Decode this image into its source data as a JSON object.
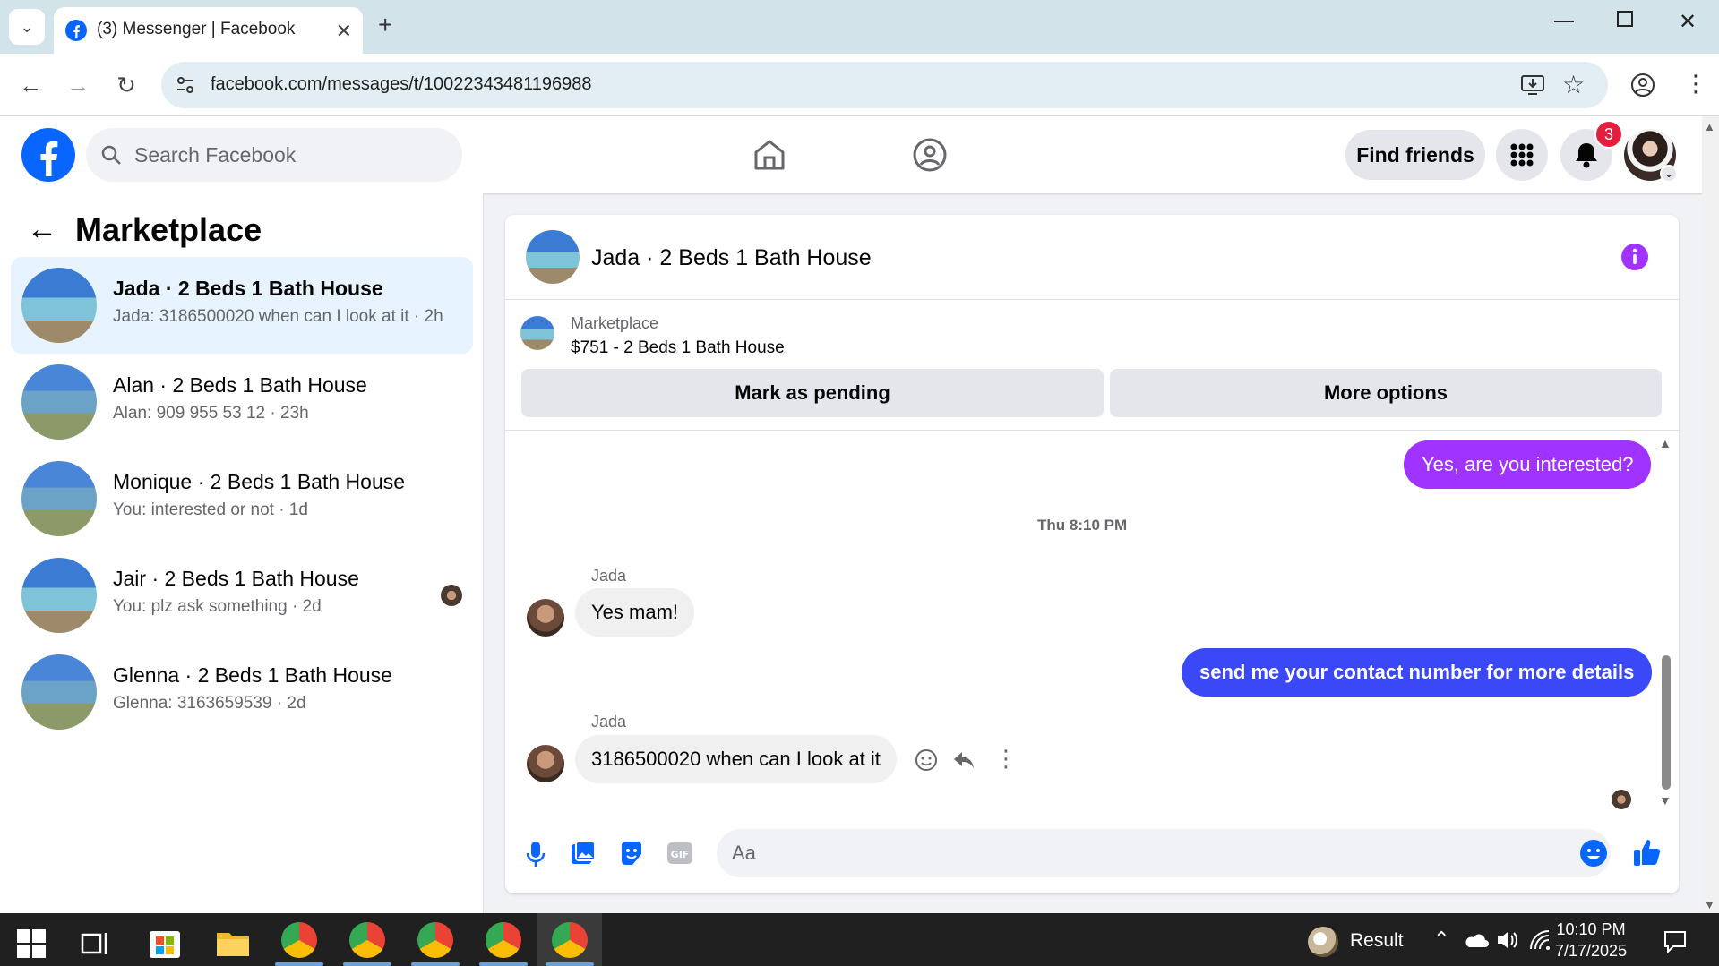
{
  "browser": {
    "tab_title": "(3) Messenger | Facebook",
    "url": "facebook.com/messages/t/10022343481196988"
  },
  "header": {
    "search_placeholder": "Search Facebook",
    "find_friends_label": "Find friends",
    "notification_count": "3"
  },
  "sidebar": {
    "title": "Marketplace",
    "conversations": [
      {
        "name": "Jada · 2 Beds 1 Bath House",
        "preview": "Jada: 3186500020 when can I look at it · 2h",
        "active": true
      },
      {
        "name": "Alan · 2 Beds 1 Bath House",
        "preview": "Alan: 909 955 53 12 · 23h",
        "active": false
      },
      {
        "name": "Monique · 2 Beds 1 Bath House",
        "preview": "You: interested or not · 1d",
        "active": false
      },
      {
        "name": "Jair · 2 Beds 1 Bath House",
        "preview": "You: plz ask something · 2d",
        "active": false
      },
      {
        "name": "Glenna · 2 Beds 1 Bath House",
        "preview": "Glenna: 3163659539 · 2d",
        "active": false
      }
    ]
  },
  "chat": {
    "title": "Jada · 2 Beds 1 Bath House",
    "listing_label": "Marketplace",
    "listing_price": "$751 - 2 Beds 1 Bath House",
    "mark_pending_label": "Mark as pending",
    "more_options_label": "More options",
    "messages": [
      {
        "from": "me",
        "text": "Yes, are you interested?"
      },
      {
        "timestamp": "Thu 8:10 PM"
      },
      {
        "from": "Jada",
        "text": "Yes mam!"
      },
      {
        "from": "me",
        "text": "send me your contact number for more details"
      },
      {
        "from": "Jada",
        "text": "3186500020 when can I look at it"
      }
    ],
    "composer_placeholder": "Aa"
  },
  "taskbar": {
    "weather_label": "Result",
    "time": "10:10 PM",
    "date": "7/17/2025"
  },
  "colors": {
    "facebook_blue": "#0866ff",
    "outgoing_purple": "#a033ff",
    "outgoing_blue": "#3a48f7",
    "messenger_accent": "#a033ff"
  }
}
